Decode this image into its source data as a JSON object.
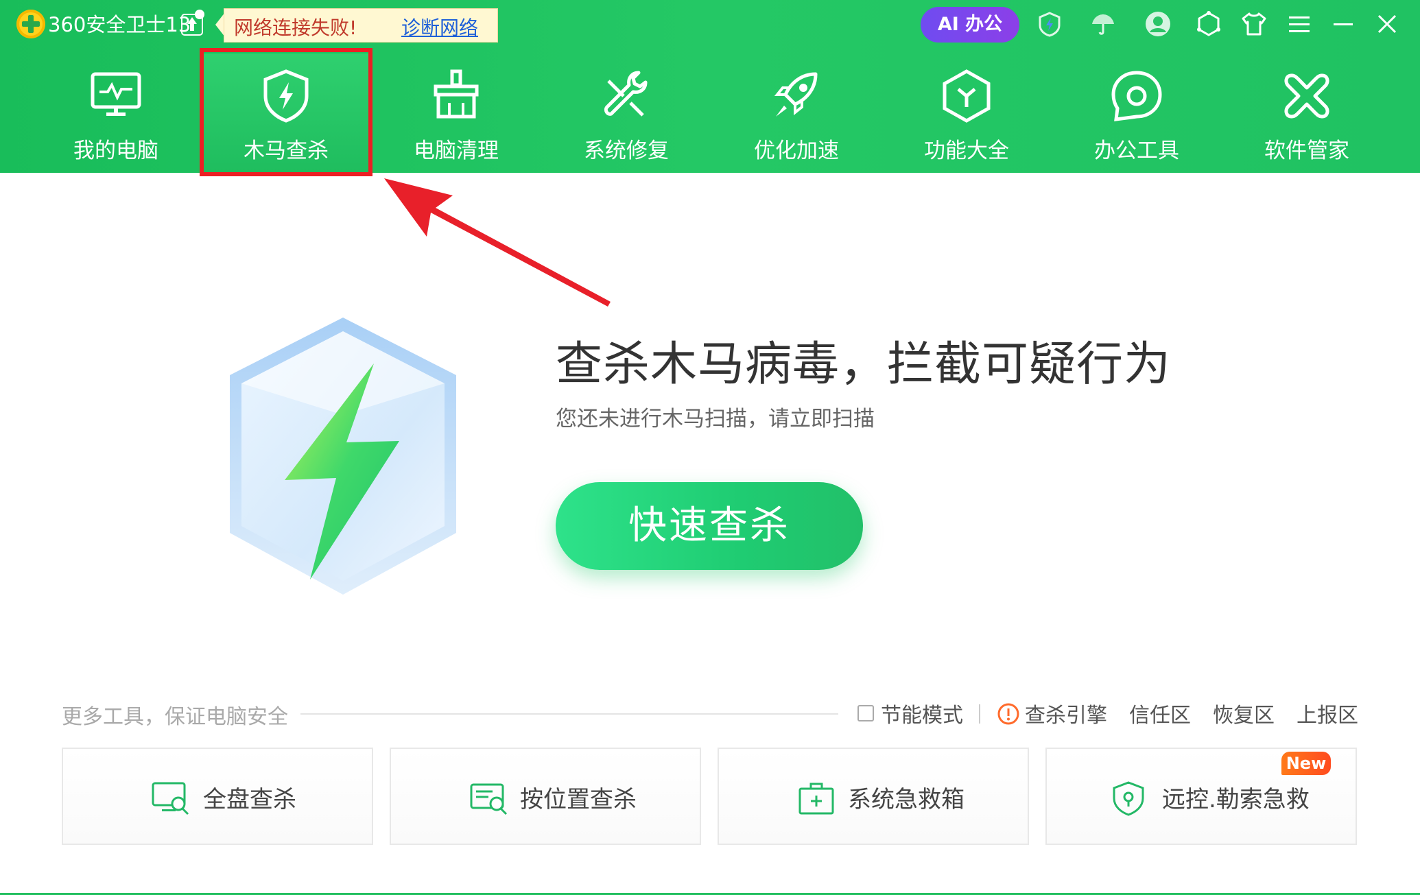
{
  "app": {
    "title": "360安全卫士13"
  },
  "notification": {
    "text": "网络连接失败!",
    "link": "诊断网络"
  },
  "titlebar": {
    "ai_badge": "AI 办公",
    "icons": [
      "speed-shield-icon",
      "umbrella-icon",
      "user-avatar-icon",
      "skin-icon",
      "shirt-icon",
      "menu-icon",
      "minimize-icon",
      "close-icon"
    ]
  },
  "nav": {
    "items": [
      {
        "label": "我的电脑",
        "icon": "monitor-icon"
      },
      {
        "label": "木马查杀",
        "icon": "shield-bolt-icon",
        "active": true
      },
      {
        "label": "电脑清理",
        "icon": "broom-icon"
      },
      {
        "label": "系统修复",
        "icon": "wrench-icon"
      },
      {
        "label": "优化加速",
        "icon": "rocket-icon"
      },
      {
        "label": "功能大全",
        "icon": "cube-icon"
      },
      {
        "label": "办公工具",
        "icon": "chat-bubble-icon"
      },
      {
        "label": "软件管家",
        "icon": "apps-icon"
      }
    ]
  },
  "main": {
    "headline": "查杀木马病毒，拦截可疑行为",
    "subline": "您还未进行木马扫描，请立即扫描",
    "scan_button": "快速查杀"
  },
  "tools": {
    "caption": "更多工具，保证电脑安全",
    "options": {
      "energy_saving": "节能模式",
      "engine": "查杀引擎",
      "trust": "信任区",
      "restore": "恢复区",
      "report": "上报区"
    },
    "cards": [
      {
        "label": "全盘查杀",
        "icon": "full-scan-icon"
      },
      {
        "label": "按位置查杀",
        "icon": "location-scan-icon"
      },
      {
        "label": "系统急救箱",
        "icon": "first-aid-icon"
      },
      {
        "label": "远控.勒索急救",
        "icon": "lock-shield-icon",
        "badge": "New"
      }
    ]
  },
  "colors": {
    "brand_green": "#24c865",
    "accent_red": "#ec1f24",
    "ai_purple": "#7b47ee",
    "new_orange": "#ff5a1f"
  }
}
